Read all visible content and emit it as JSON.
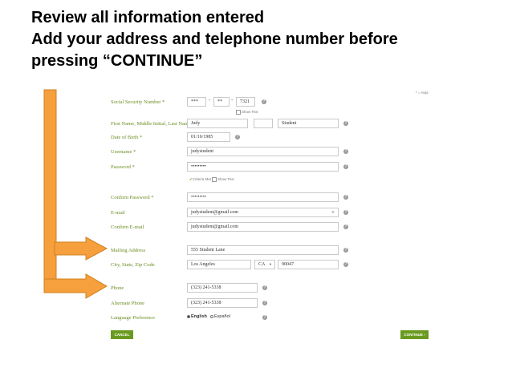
{
  "slide": {
    "title_line1": "Review all information entered",
    "title_line2": "Add your address and telephone number before",
    "title_line3": "pressing “CONTINUE”"
  },
  "form": {
    "required_note": "* = reqs",
    "ssn": {
      "label": "Social Security Number *",
      "part1": "***",
      "part2": "**",
      "part3": "7321",
      "show_text": "Show Text"
    },
    "name": {
      "label": "First Name, Middle Initial, Last Name *",
      "first": "Judy",
      "middle": "",
      "last": "Student"
    },
    "dob": {
      "label": "Date of Birth *",
      "value": "01/16/1985"
    },
    "username": {
      "label": "Username *",
      "value": "judystudent"
    },
    "password": {
      "label": "Password *",
      "value": "•••••••••",
      "criteria": "Criteria Met",
      "show_text": "Show Text"
    },
    "confirm_password": {
      "label": "Confirm Password *",
      "value": "•••••••••"
    },
    "email": {
      "label": "E-mail",
      "value": "judystudent@gmail.com",
      "clear": "×"
    },
    "confirm_email": {
      "label": "Confirm E-mail",
      "value": "judystudent@gmail.com"
    },
    "mailing_address": {
      "label": "Mailing Address",
      "value": "555 Student Lane"
    },
    "city_state_zip": {
      "label": "City, State, Zip Code",
      "city": "Los Angeles",
      "state": "CA",
      "zip": "90047"
    },
    "phone": {
      "label": "Phone",
      "value": "(323) 241-5338"
    },
    "alt_phone": {
      "label": "Alternate Phone",
      "value": "(323) 241-5338"
    },
    "language": {
      "label": "Language Preference",
      "option1": "English",
      "option2": "Español"
    },
    "cancel_label": "CANCEL",
    "continue_label": "CONTINUE ›"
  },
  "colors": {
    "label_green": "#6b8e23",
    "button_green": "#6a9a1f",
    "arrow_orange": "#f5a03c"
  }
}
